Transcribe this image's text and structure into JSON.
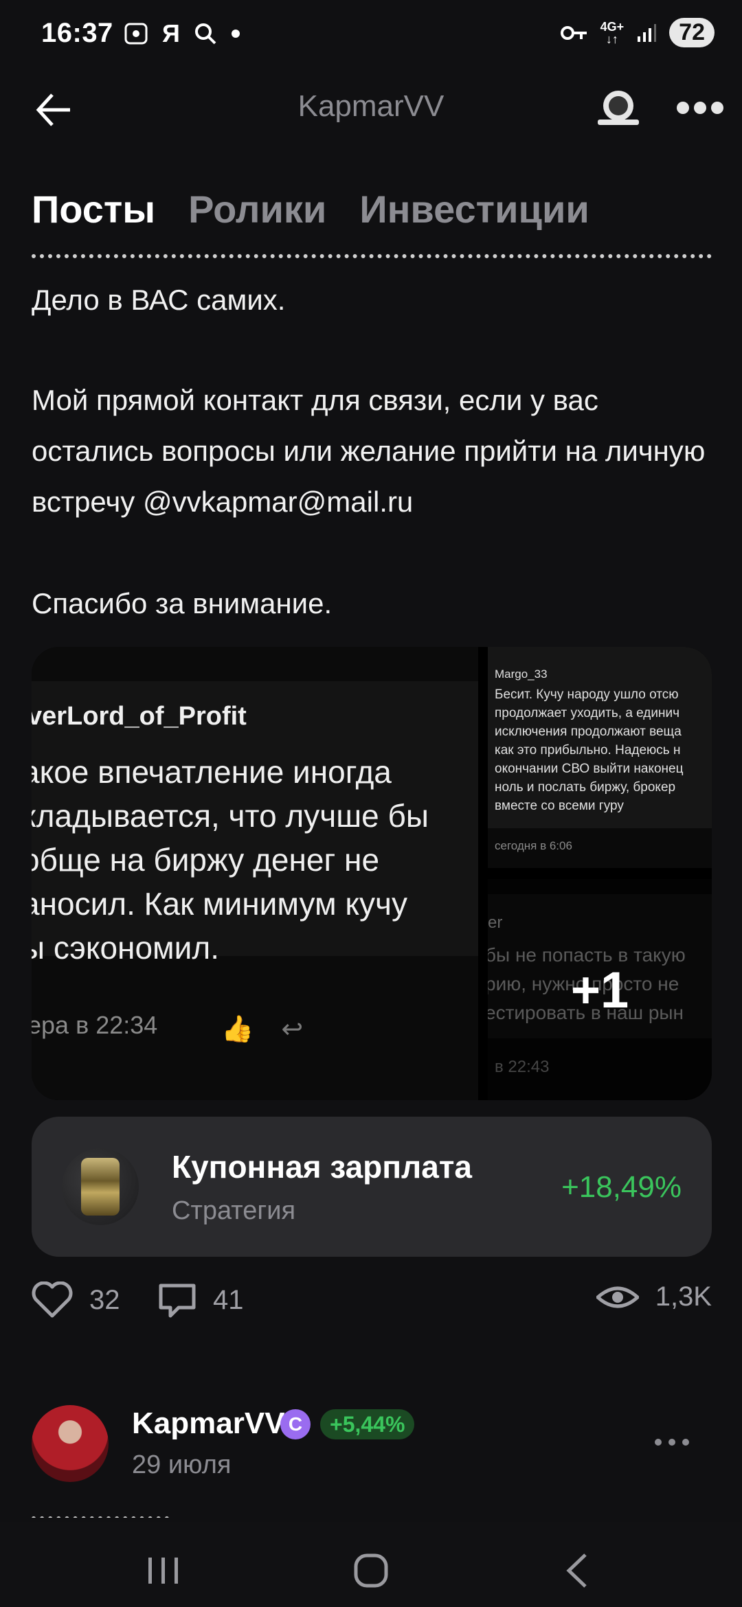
{
  "status_bar": {
    "time": "16:37",
    "left_icons": [
      "gallery-icon",
      "yandex-icon",
      "search-icon",
      "dot-icon"
    ],
    "yandex_label": "Я",
    "network_top": "4G+",
    "network_bottom": "↓↑",
    "battery": "72"
  },
  "header": {
    "title": "KapmarVV",
    "back_icon": "arrow-left-icon",
    "avatar_icon": "profile-icon",
    "more_icon": "more-dots-icon"
  },
  "tabs": [
    {
      "label": "Посты",
      "active": true
    },
    {
      "label": "Ролики",
      "active": false
    },
    {
      "label": "Инвестиции",
      "active": false
    }
  ],
  "post": {
    "line1": "Дело в ВАС самих.",
    "paragraph2": "Мой прямой контакт для связи, если у вас остались вопросы или желание прийти на личную встречу @vvkapmar@mail.ru",
    "paragraph3": "Спасибо за внимание."
  },
  "gallery": {
    "main": {
      "author": "verLord_of_Profit",
      "quote_lines": [
        "акое впечатление иногда",
        "кладывается, что лучше бы",
        "обще на биржу денег не",
        "аносил. Как минимум кучу",
        "ы сэкономил."
      ],
      "time": "ера в 22:34"
    },
    "top": {
      "user": "Margo_33",
      "lines": [
        "Бесит. Кучу народу ушло отсю",
        "продолжает уходить, а единич",
        "исключения продолжают веща",
        "как это прибыльно. Надеюсь н",
        "окончании СВО выйти наконец",
        "ноль и послать биржу, брокер",
        "вместе со всеми гуру"
      ],
      "time": "сегодня в 6:06"
    },
    "bottom": {
      "user": "er",
      "lines": [
        "бы не попасть в такую",
        "рию, нужно просто не",
        "естировать в наш рын"
      ],
      "time": "в 22:43",
      "more_label": "+1"
    }
  },
  "strategy": {
    "title": "Купонная зарплата",
    "subtitle": "Стратегия",
    "value": "+18,49%",
    "value_color": "#3ac55c"
  },
  "reactions": {
    "likes": "32",
    "comments": "41",
    "views": "1,3K"
  },
  "next_post": {
    "name": "KapmarVV",
    "badge": "C",
    "percent": "+5,44%",
    "date": "29 июля"
  },
  "nav": [
    "recent-apps-icon",
    "home-icon",
    "back-icon"
  ]
}
